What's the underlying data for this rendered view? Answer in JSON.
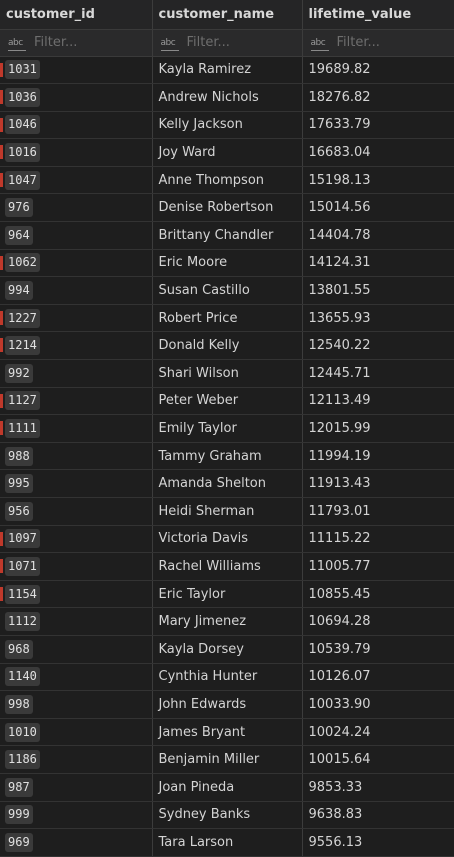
{
  "columns": [
    {
      "label": "customer_id"
    },
    {
      "label": "customer_name"
    },
    {
      "label": "lifetime_value"
    }
  ],
  "filter_placeholder": "Filter...",
  "filter_icon_text": "abc",
  "rows": [
    {
      "id": "1031",
      "name": "Kayla Ramirez",
      "value": "19689.82",
      "marker": true
    },
    {
      "id": "1036",
      "name": "Andrew Nichols",
      "value": "18276.82",
      "marker": true
    },
    {
      "id": "1046",
      "name": "Kelly Jackson",
      "value": "17633.79",
      "marker": true
    },
    {
      "id": "1016",
      "name": "Joy Ward",
      "value": "16683.04",
      "marker": true
    },
    {
      "id": "1047",
      "name": "Anne Thompson",
      "value": "15198.13",
      "marker": true
    },
    {
      "id": "976",
      "name": "Denise Robertson",
      "value": "15014.56",
      "marker": false
    },
    {
      "id": "964",
      "name": "Brittany Chandler",
      "value": "14404.78",
      "marker": false
    },
    {
      "id": "1062",
      "name": "Eric Moore",
      "value": "14124.31",
      "marker": true
    },
    {
      "id": "994",
      "name": "Susan Castillo",
      "value": "13801.55",
      "marker": false
    },
    {
      "id": "1227",
      "name": "Robert Price",
      "value": "13655.93",
      "marker": true
    },
    {
      "id": "1214",
      "name": "Donald Kelly",
      "value": "12540.22",
      "marker": true
    },
    {
      "id": "992",
      "name": "Shari Wilson",
      "value": "12445.71",
      "marker": false
    },
    {
      "id": "1127",
      "name": "Peter Weber",
      "value": "12113.49",
      "marker": true
    },
    {
      "id": "1111",
      "name": "Emily Taylor",
      "value": "12015.99",
      "marker": true
    },
    {
      "id": "988",
      "name": "Tammy Graham",
      "value": "11994.19",
      "marker": false
    },
    {
      "id": "995",
      "name": "Amanda Shelton",
      "value": "11913.43",
      "marker": false
    },
    {
      "id": "956",
      "name": "Heidi Sherman",
      "value": "11793.01",
      "marker": false
    },
    {
      "id": "1097",
      "name": "Victoria Davis",
      "value": "11115.22",
      "marker": true
    },
    {
      "id": "1071",
      "name": "Rachel Williams",
      "value": "11005.77",
      "marker": true
    },
    {
      "id": "1154",
      "name": "Eric Taylor",
      "value": "10855.45",
      "marker": true
    },
    {
      "id": "1112",
      "name": "Mary Jimenez",
      "value": "10694.28",
      "marker": false
    },
    {
      "id": "968",
      "name": "Kayla Dorsey",
      "value": "10539.79",
      "marker": false
    },
    {
      "id": "1140",
      "name": "Cynthia Hunter",
      "value": "10126.07",
      "marker": false
    },
    {
      "id": "998",
      "name": "John Edwards",
      "value": "10033.90",
      "marker": false
    },
    {
      "id": "1010",
      "name": "James Bryant",
      "value": "10024.24",
      "marker": false
    },
    {
      "id": "1186",
      "name": "Benjamin Miller",
      "value": "10015.64",
      "marker": false
    },
    {
      "id": "987",
      "name": "Joan Pineda",
      "value": "9853.33",
      "marker": false
    },
    {
      "id": "999",
      "name": "Sydney Banks",
      "value": "9638.83",
      "marker": false
    },
    {
      "id": "969",
      "name": "Tara Larson",
      "value": "9556.13",
      "marker": false
    }
  ],
  "colors": {
    "background": "#1e1e1e",
    "header": "#252526",
    "chip": "#3a3a3a",
    "marker": "#c0392b"
  }
}
